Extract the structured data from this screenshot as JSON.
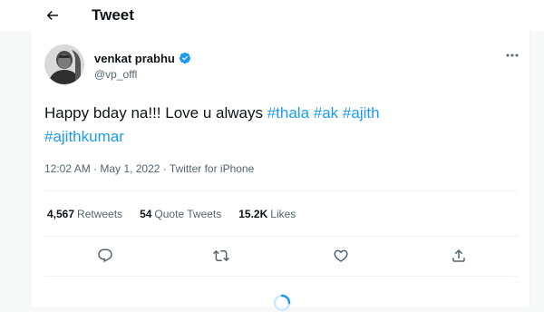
{
  "header": {
    "title": "Tweet",
    "back_icon": "arrow-left-icon"
  },
  "tweet": {
    "author": {
      "display_name": "venkat prabhu",
      "handle": "@vp_offl",
      "verified": true
    },
    "text": {
      "plain": "Happy bday na!!! Love u always ",
      "hashtags": [
        "#thala",
        "#ak",
        "#ajith",
        "#ajithkumar"
      ]
    },
    "meta": {
      "time": "12:02 AM",
      "separator": "·",
      "date": "May 1, 2022",
      "source": "Twitter for iPhone"
    },
    "stats": {
      "retweets_count": "4,567",
      "retweets_label": "Retweets",
      "quotes_count": "54",
      "quotes_label": "Quote Tweets",
      "likes_count": "15.2K",
      "likes_label": "Likes"
    },
    "actions": [
      "reply-icon",
      "retweet-icon",
      "like-icon",
      "share-icon"
    ]
  },
  "colors": {
    "accent": "#1d9bf0",
    "text_primary": "#0f1419",
    "text_secondary": "#536471",
    "divider": "#eff3f4",
    "background": "#f7f9f9"
  }
}
